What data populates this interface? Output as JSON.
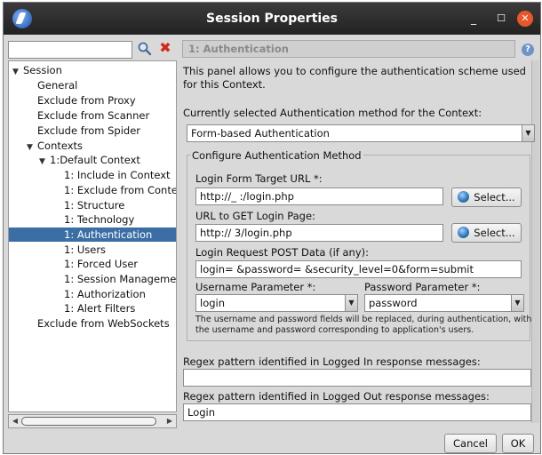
{
  "window": {
    "title": "Session Properties",
    "minimize_glyph": "_",
    "maximize_glyph": "☐",
    "close_glyph": "✕"
  },
  "tree": {
    "nodes": [
      {
        "label": "Session",
        "toggle": "▼",
        "expanded": true
      },
      {
        "label": "General"
      },
      {
        "label": "Exclude from Proxy"
      },
      {
        "label": "Exclude from Scanner"
      },
      {
        "label": "Exclude from Spider"
      },
      {
        "label": "Contexts",
        "toggle": "▼",
        "expanded": true
      },
      {
        "label": "1:Default Context",
        "toggle": "▼",
        "expanded": true
      },
      {
        "label": "1: Include in Context"
      },
      {
        "label": "1: Exclude from Conte"
      },
      {
        "label": "1: Structure"
      },
      {
        "label": "1: Technology"
      },
      {
        "label": "1: Authentication",
        "selected": true
      },
      {
        "label": "1: Users"
      },
      {
        "label": "1: Forced User"
      },
      {
        "label": "1: Session Managemer"
      },
      {
        "label": "1: Authorization"
      },
      {
        "label": "1: Alert Filters"
      },
      {
        "label": "Exclude from WebSockets"
      }
    ]
  },
  "panel": {
    "header": "1: Authentication",
    "description_line1": "This panel allows you to configure the authentication scheme used",
    "description_line2": "for this Context.",
    "method_label": "Currently selected Authentication method for the Context:",
    "method_value": "Form-based Authentication",
    "configure_title": "Configure Authentication Method",
    "login_target_label": "Login Form Target URL *:",
    "login_target_value": "http://_                    :/login.php",
    "url_get_label": "URL to GET Login Page:",
    "url_get_value": "http://               3/login.php",
    "select_label": "Select...",
    "post_data_label": "Login Request POST Data (if any):",
    "post_data_value": "login=   &password=      &security_level=0&form=submit",
    "username_param_label": "Username Parameter *:",
    "username_param_value": "login",
    "password_param_label": "Password Parameter *:",
    "password_param_value": "password",
    "note_line1": "The username and password fields will be replaced, during authentication, with",
    "note_line2": "the username and password corresponding to application's users.",
    "regex_in_label": "Regex pattern identified in Logged In response messages:",
    "regex_in_value": "",
    "regex_out_label": "Regex pattern identified in Logged Out response messages:",
    "regex_out_value": "Login"
  },
  "footer": {
    "cancel_label": "Cancel",
    "ok_label": "OK"
  },
  "colors": {
    "selection": "#3a6ea5",
    "titlebar": "#2b2b2b",
    "close": "#e8572a"
  }
}
